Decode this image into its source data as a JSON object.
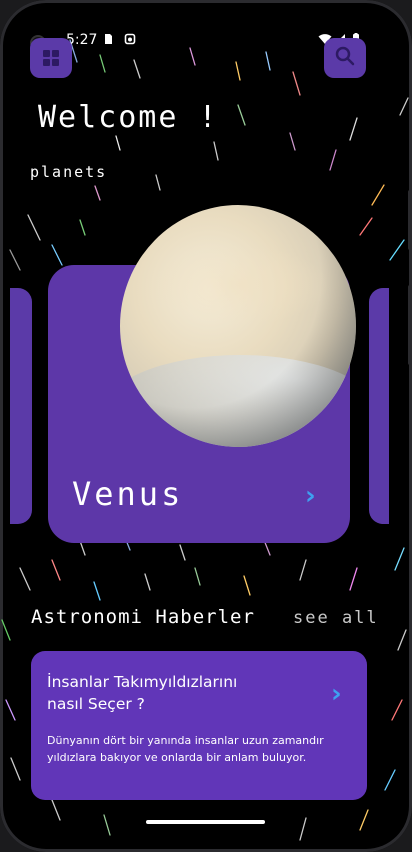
{
  "status_bar": {
    "time": "5:27"
  },
  "header": {
    "title": "Welcome !",
    "subtitle": "planets",
    "menu_icon": "grid-icon",
    "search_icon": "search-icon"
  },
  "planet_card": {
    "name": "Venus",
    "arrow_icon": "chevron-right-icon"
  },
  "news": {
    "section_title": "Astronomi Haberler",
    "see_all": "see all",
    "item": {
      "title": "İnsanlar Takımyıldızlarını\n nasıl Seçer ?",
      "body": "Dünyanın dört bir yanında insanlar uzun zamandır yıldızlara bakıyor ve onlarda bir anlam buluyor.",
      "arrow_icon": "chevron-right-icon"
    }
  },
  "colors": {
    "background": "#000000",
    "card": "#5d37a8",
    "news_card": "#6136b8",
    "accent": "#3ea0f0"
  }
}
